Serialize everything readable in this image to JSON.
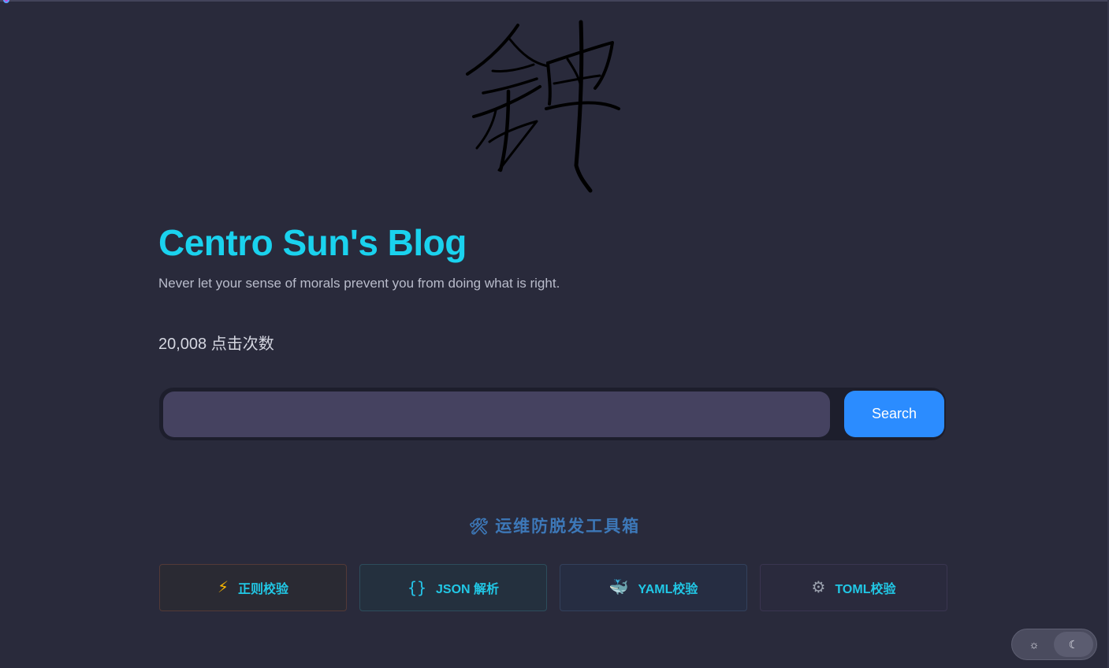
{
  "header": {
    "title": "Centro Sun's Blog",
    "subtitle": "Never let your sense of morals prevent you from doing what is right."
  },
  "stats": {
    "visits": "20,008 点击次数"
  },
  "search": {
    "placeholder": "",
    "value": "",
    "button_label": "Search"
  },
  "toolbox": {
    "heading_icon": "hammer-wrench-icon",
    "heading": "运维防脱发工具箱",
    "items": [
      {
        "icon": "lightning-icon",
        "label": "正则校验"
      },
      {
        "icon": "braces-icon",
        "label": "JSON 解析"
      },
      {
        "icon": "whale-icon",
        "label": "YAML校验"
      },
      {
        "icon": "gear-icon",
        "label": "TOML校验"
      }
    ]
  },
  "theme": {
    "light_icon": "sun-icon",
    "dark_icon": "moon-icon"
  },
  "colors": {
    "background": "#292a3b",
    "title": "#1ad2ee",
    "accent": "#2b8cff",
    "heading": "#3d78b8"
  }
}
